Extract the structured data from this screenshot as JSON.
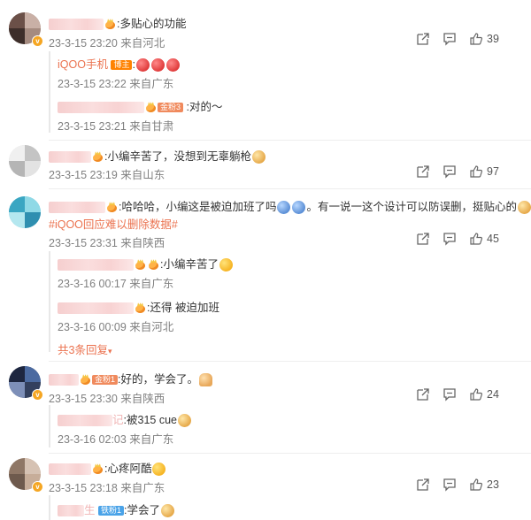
{
  "comments": [
    {
      "text": ":多贴心的功能",
      "meta": "23-3-15 23:20 来自河北",
      "likes": "39",
      "replies": [
        {
          "name": "iQOO手机",
          "badge": "博主",
          "text": ":",
          "meta": "23-3-15 23:22 来自广东"
        },
        {
          "name_suffix": "",
          "badge": "金粉3",
          "text": ":对的～",
          "meta": "23-3-15 23:21 来自甘肃"
        }
      ]
    },
    {
      "text": ":小编辛苦了，没想到无辜躺枪",
      "meta": "23-3-15 23:19 来自山东",
      "likes": "97"
    },
    {
      "text": ":哈哈哈，小编这是被迫加班了吗",
      "text2": "。有一说一这个设计可以防误删，挺贴心的",
      "hashtag": "#iQOO回应难以删除数据#",
      "meta": "23-3-15 23:31 来自陕西",
      "likes": "45",
      "replies": [
        {
          "text": ":小编辛苦了",
          "meta": "23-3-16 00:17 来自广东"
        },
        {
          "text": ":还得  被迫加班",
          "meta": "23-3-16 00:09 来自河北"
        }
      ],
      "more": "共3条回复"
    },
    {
      "badge": "金粉1",
      "text": ":好的，学会了。",
      "meta": "23-3-15 23:30 来自陕西",
      "likes": "24",
      "replies": [
        {
          "name_suffix": "记",
          "text": ":被315 cue",
          "meta": "23-3-16 02:03 来自广东"
        }
      ]
    },
    {
      "text": ":心疼阿酷",
      "meta": "23-3-15 23:18 来自广东",
      "likes": "23",
      "replies": [
        {
          "name_suffix": "生",
          "badge": "铁粉1",
          "text": ":学会了"
        }
      ]
    }
  ],
  "colors": {
    "accent": "#eb7350",
    "meta": "#808080"
  },
  "icons": [
    "share-icon",
    "comment-icon",
    "like-icon"
  ]
}
